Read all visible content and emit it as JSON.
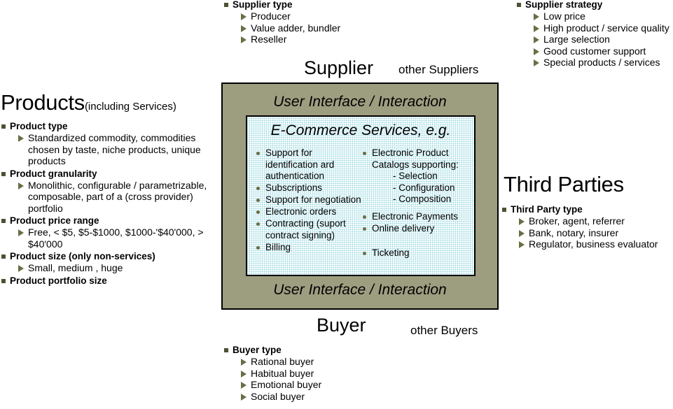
{
  "supplier": {
    "title": "Supplier",
    "other_label": "other Suppliers",
    "type_group": {
      "heading": "Supplier type",
      "items": [
        "Producer",
        "Value adder, bundler",
        "Reseller"
      ]
    },
    "strategy_group": {
      "heading": "Supplier strategy",
      "items": [
        "Low price",
        "High product / service quality",
        "Large selection",
        "Good customer support",
        "Special products / services"
      ]
    }
  },
  "products": {
    "title": "Products",
    "subtitle": "(including Services)",
    "groups": [
      {
        "heading": "Product type",
        "items": [
          "Standardized commodity, commodities chosen by taste, niche products, unique products"
        ]
      },
      {
        "heading": "Product granularity",
        "items": [
          "Monolithic, configurable / parametrizable, composable, part of a (cross provider) portfolio"
        ]
      },
      {
        "heading": "Product price range",
        "items": [
          "Free, < $5, $5-$1000, $1000-'$40'000, > $40'000"
        ]
      },
      {
        "heading": "Product size (only non-services)",
        "items": [
          "Small, medium , huge"
        ]
      },
      {
        "heading": "Product portfolio size",
        "items": []
      }
    ]
  },
  "framework": {
    "ui_band_top": "User Interface / Interaction",
    "ui_band_bottom": "User Interface / Interaction",
    "services_title": "E-Commerce Services, e.g.",
    "services_left": [
      {
        "label": "Support for identification ard authentication"
      },
      {
        "label": "Subscriptions"
      },
      {
        "label": "Support for negotiation"
      },
      {
        "label": "Electronic orders"
      },
      {
        "label": "Contracting (suport contract signing)"
      },
      {
        "label": "Billing"
      }
    ],
    "services_right": [
      {
        "label": "Electronic Product Catalogs supporting:",
        "sub": [
          "- Selection",
          "- Configuration",
          "- Composition"
        ]
      },
      {
        "label": "Electronic Payments",
        "sub": []
      },
      {
        "label": "Online delivery",
        "sub": []
      },
      {
        "label": "Ticketing",
        "sub": []
      }
    ]
  },
  "third_parties": {
    "title": "Third Parties",
    "group": {
      "heading": "Third Party type",
      "items": [
        "Broker, agent, referrer",
        "Bank, notary, insurer",
        "Regulator, business evaluator"
      ]
    }
  },
  "buyer": {
    "title": "Buyer",
    "other_label": "other Buyers",
    "type_group": {
      "heading": "Buyer type",
      "items": [
        "Rational buyer",
        "Habitual buyer",
        "Emotional buyer",
        "Social buyer"
      ]
    }
  },
  "colors": {
    "frame_fill": "#9d9d80",
    "services_fill": "#ffffff",
    "services_pattern": "#96d7e1",
    "bullet_square": "#4e5033",
    "bullet_triangle": "#6b6d45",
    "text": "#000000"
  }
}
